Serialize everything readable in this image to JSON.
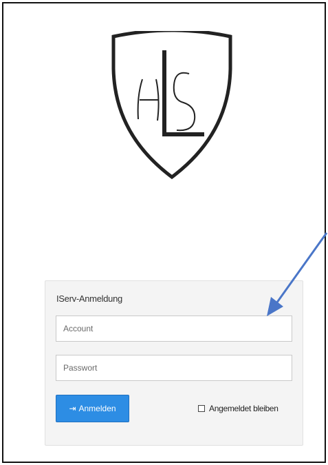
{
  "logo": {
    "letters": "HLS"
  },
  "login": {
    "title": "IServ-Anmeldung",
    "account_placeholder": "Account",
    "password_placeholder": "Passwort",
    "submit_label": "Anmelden",
    "submit_icon": "login-icon",
    "remember_label": "Angemeldet bleiben"
  },
  "colors": {
    "primary_button": "#2d8de4",
    "arrow": "#4a76c8",
    "panel_bg": "#f4f4f4"
  },
  "annotation": {
    "arrow_icon": "arrow-annotation-icon"
  }
}
